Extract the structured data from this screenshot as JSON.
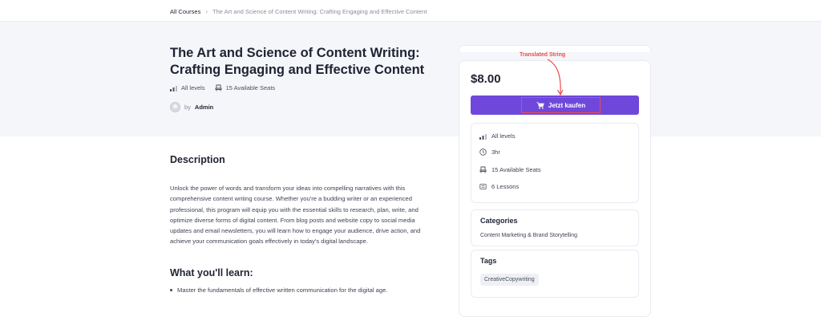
{
  "breadcrumb": {
    "root": "All Courses",
    "separator": "›",
    "current": "The Art and Science of Content Writing: Crafting Engaging and Effective Content"
  },
  "course": {
    "title": "The Art and Science of Content Writing: Crafting Engaging and Effective Content",
    "level": "All levels",
    "seats": "15 Available Seats",
    "author_prefix": "by",
    "author": "Admin"
  },
  "description": {
    "heading": "Description",
    "text": "Unlock the power of words and transform your ideas into compelling narratives with this comprehensive content writing course. Whether you're a budding writer or an experienced professional, this program will equip you with the essential skills to research, plan, write, and optimize diverse forms of digital content. From blog posts and website copy to social media updates and email newsletters, you will learn how to engage your audience, drive action, and achieve your communication goals effectively in today's digital landscape."
  },
  "learn": {
    "heading": "What you'll learn:",
    "items": [
      "Master the fundamentals of effective written communication for the digital age."
    ]
  },
  "sidebar": {
    "price": "$8.00",
    "buy_label": "Jetzt kaufen",
    "annotation": "Translated String",
    "info": {
      "level": "All levels",
      "duration": "3hr",
      "seats": "15 Available Seats",
      "lessons": "6 Lessons"
    },
    "categories_heading": "Categories",
    "categories_value": "Content Marketing & Brand Storytelling",
    "tags_heading": "Tags",
    "tags": [
      "CreativeCopywriting"
    ]
  },
  "colors": {
    "accent": "#6f48db",
    "annotation": "#ef4b4b",
    "hero_bg": "#f5f6fa"
  },
  "icons": [
    "level-bars-icon",
    "seat-icon",
    "clock-icon",
    "lessons-icon",
    "cart-icon",
    "avatar-icon",
    "chevron-right-icon"
  ]
}
